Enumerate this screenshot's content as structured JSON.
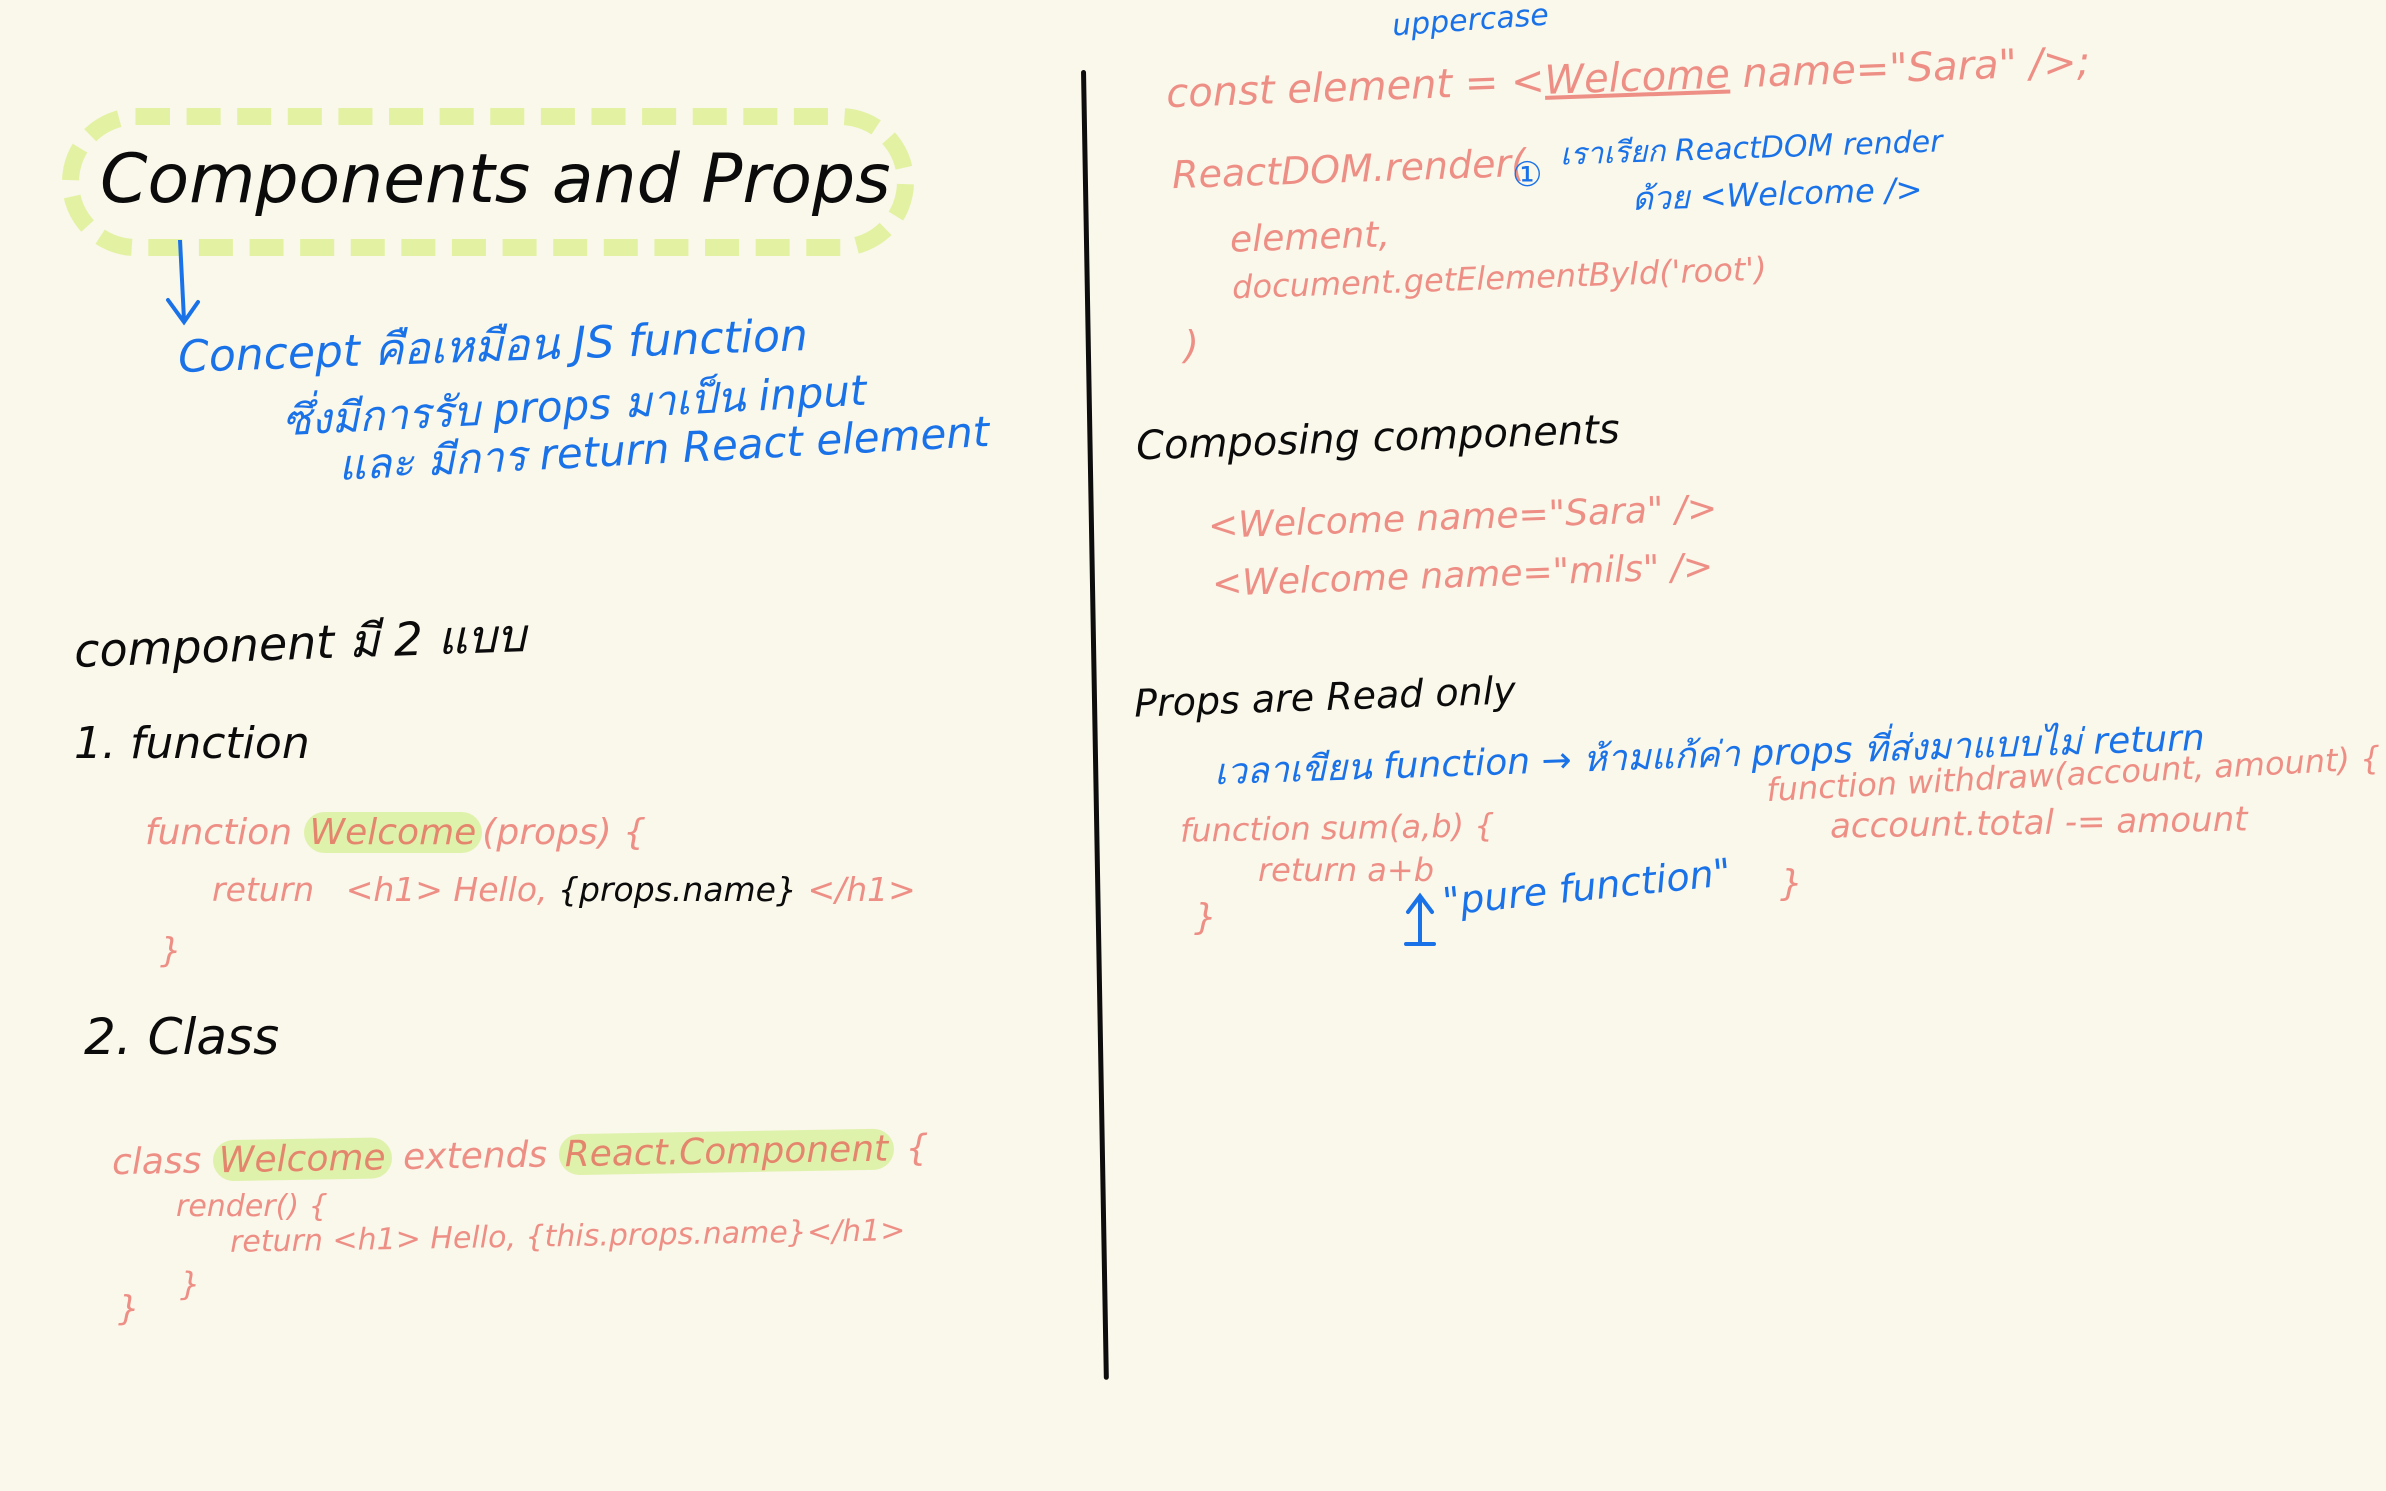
{
  "title": "Components and Props",
  "concept": {
    "line1": "Concept คือเหมือน JS function",
    "line2": "ซึ่งมีการรับ props มาเป็น input",
    "line3": "และ มีการ return React element"
  },
  "component_types": {
    "heading": "component มี 2 แบบ",
    "function_heading": "1. function",
    "function_code": {
      "kw": "function",
      "name": "Welcome",
      "params": "(props) {",
      "return_kw": "return",
      "return_open": "<h1> Hello,",
      "expr": "{props.name}",
      "return_close": "</h1>",
      "close": "}"
    },
    "class_heading": "2. Class",
    "class_code": {
      "kw": "class",
      "name": "Welcome",
      "extends": "extends",
      "parent": "React.Component",
      "brace": "{",
      "render": "render() {",
      "return": "return <h1> Hello, {this.props.name}</h1>",
      "close_inner": "}",
      "close_outer": "}"
    }
  },
  "render": {
    "annotation": "uppercase",
    "element_prefix": "const element = <",
    "element_tag": "Welcome",
    "element_attrs": " name=\"Sara\" />;",
    "render_line": "ReactDOM.render(",
    "arg1": "element,",
    "arg2": "document.getElementById('root')",
    "close": ")",
    "note_marker": "①",
    "note_line1": "เราเรียก ReactDOM render",
    "note_line2": "ด้วย <Welcome />"
  },
  "composing": {
    "heading": "Composing components",
    "line1": "<Welcome name=\"Sara\" />",
    "line2": "<Welcome name=\"mils\" />"
  },
  "readonly": {
    "heading": "Props are Read only",
    "note": "เวลาเขียน function → ห้ามแก้ค่า props ที่ส่งมาแบบไม่ return",
    "sum_line1": "function sum(a,b) {",
    "sum_line2": "return a+b",
    "sum_close": "}",
    "pure_note": "\"pure function\"",
    "withdraw_line1": "function withdraw(account, amount) {",
    "withdraw_line2": "account.total -= amount",
    "withdraw_close": "}"
  },
  "colors": {
    "background": "#faf7eb",
    "ink_black": "#0b0b0b",
    "code_pink": "#ee8f86",
    "note_blue": "#1a72e8",
    "highlight_green": "#e3f2a2"
  }
}
